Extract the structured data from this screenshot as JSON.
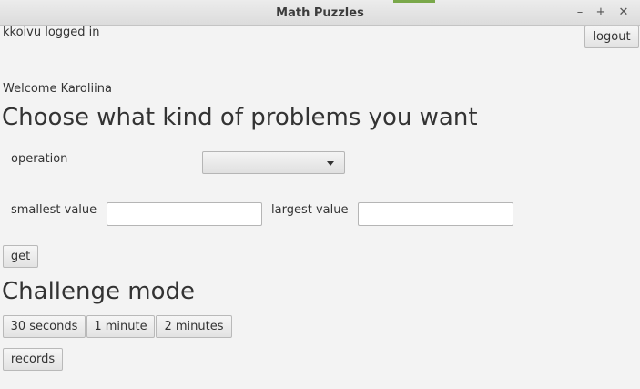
{
  "window": {
    "title": "Math Puzzles",
    "controls": {
      "minimize": "–",
      "maximize": "+",
      "close": "✕"
    }
  },
  "session": {
    "logged_in_text": "kkoivu logged in",
    "logout_label": "logout",
    "welcome_text": "Welcome Karoliina"
  },
  "problems": {
    "heading": "Choose what kind of problems you want",
    "operation_label": "operation",
    "operation_selected": "",
    "smallest_label": "smallest value",
    "smallest_value": "",
    "largest_label": "largest value",
    "largest_value": "",
    "get_label": "get"
  },
  "challenge": {
    "heading": "Challenge mode",
    "buttons": [
      "30 seconds",
      "1 minute",
      "2 minutes"
    ],
    "records_label": "records"
  },
  "colors": {
    "background": "#f3f3f3",
    "titlebar_accent": "#7aa84a"
  }
}
